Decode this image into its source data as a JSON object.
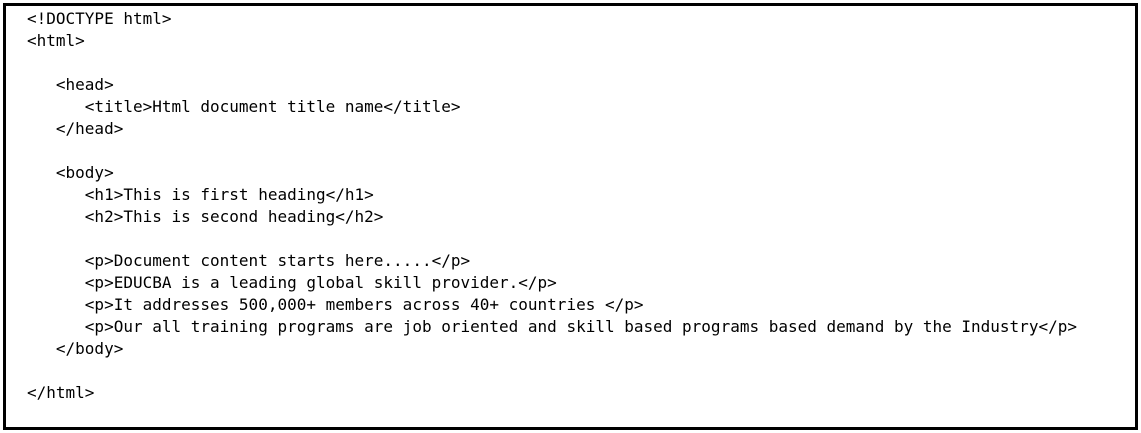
{
  "code": {
    "lines": [
      "<!DOCTYPE html>",
      "<html>",
      "",
      "   <head>",
      "      <title>Html document title name</title>",
      "   </head>",
      "",
      "   <body>",
      "      <h1>This is first heading</h1>",
      "      <h2>This is second heading</h2>",
      "",
      "      <p>Document content starts here.....</p>",
      "      <p>EDUCBA is a leading global skill provider.</p>",
      "      <p>It addresses 500,000+ members across 40+ countries </p>",
      "      <p>Our all training programs are job oriented and skill based programs based demand by the Industry</p>",
      "   </body>",
      "",
      "</html>"
    ]
  }
}
